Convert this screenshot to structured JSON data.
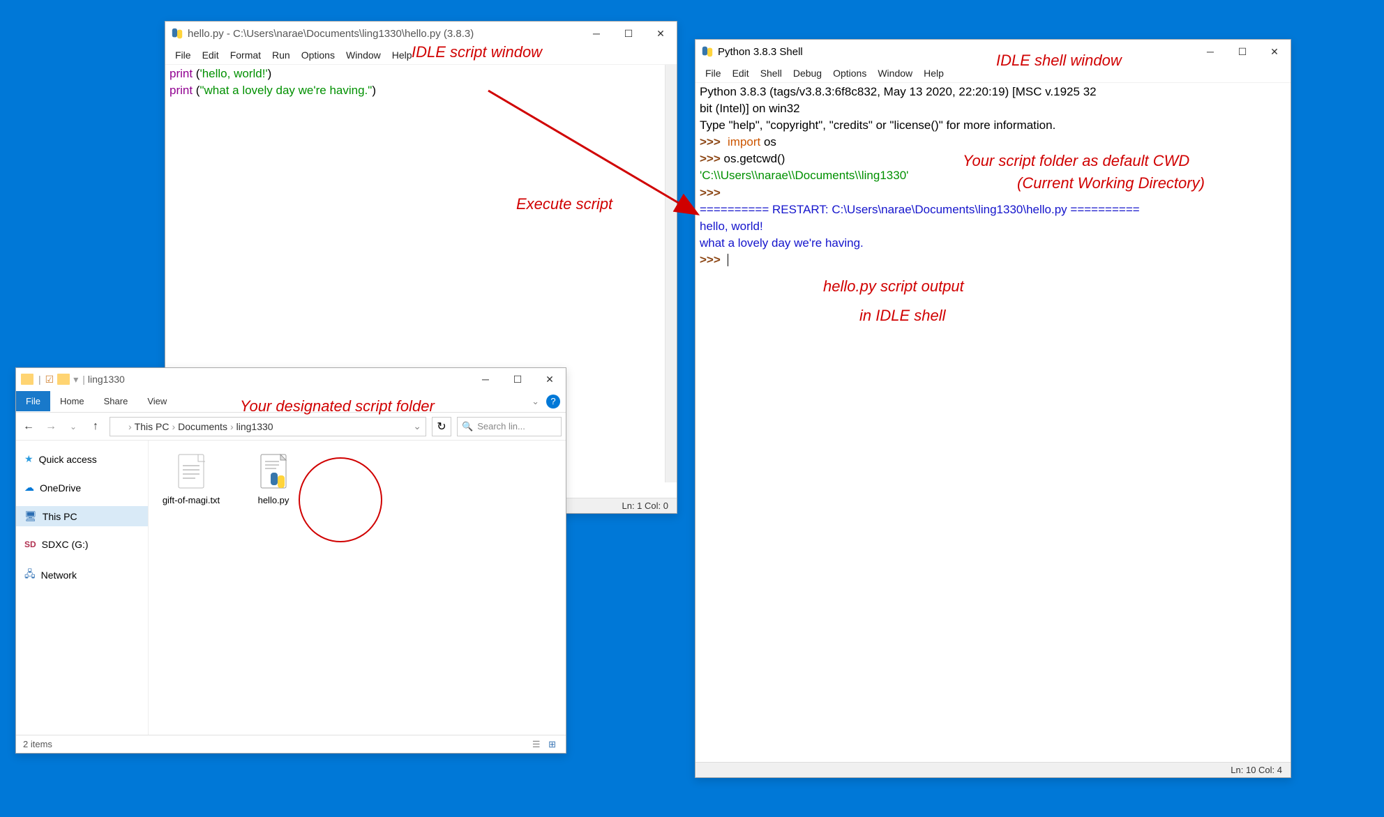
{
  "idle_script": {
    "title": "hello.py - C:\\Users\\narae\\Documents\\ling1330\\hello.py (3.8.3)",
    "menus": [
      "File",
      "Edit",
      "Format",
      "Run",
      "Options",
      "Window",
      "Help"
    ],
    "code": {
      "line1_fn": "print",
      "line1_rest": " (",
      "line1_str": "'hello, world!'",
      "line1_end": ")",
      "line2_fn": "print",
      "line2_rest": " (",
      "line2_str": "\"what a lovely day we're having.\"",
      "line2_end": ")"
    },
    "status": "Ln: 1  Col: 0"
  },
  "idle_shell": {
    "title": "Python 3.8.3 Shell",
    "menus": [
      "File",
      "Edit",
      "Shell",
      "Debug",
      "Options",
      "Window",
      "Help"
    ],
    "banner1": "Python 3.8.3 (tags/v3.8.3:6f8c832, May 13 2020, 22:20:19) [MSC v.1925 32",
    "banner2": "bit (Intel)] on win32",
    "banner3": "Type \"help\", \"copyright\", \"credits\" or \"license()\" for more information.",
    "prompt": ">>>",
    "import_kw": "import",
    "import_mod": " os",
    "getcwd": " os.getcwd()",
    "cwd_result": "'C:\\\\Users\\\\narae\\\\Documents\\\\ling1330'",
    "restart": "========== RESTART: C:\\Users\\narae\\Documents\\ling1330\\hello.py ==========",
    "out1": "hello, world!",
    "out2": "what a lovely day we're having.",
    "status": "Ln: 10  Col: 4"
  },
  "explorer": {
    "title_folder": "ling1330",
    "tabs": {
      "file": "File",
      "home": "Home",
      "share": "Share",
      "view": "View"
    },
    "breadcrumb": [
      "This PC",
      "Documents",
      "ling1330"
    ],
    "search_placeholder": "Search lin...",
    "sidebar": [
      {
        "label": "Quick access",
        "icon": "star-icon"
      },
      {
        "label": "OneDrive",
        "icon": "cloud-icon"
      },
      {
        "label": "This PC",
        "icon": "pc-icon"
      },
      {
        "label": "SDXC (G:)",
        "icon": "sd-icon"
      },
      {
        "label": "Network",
        "icon": "network-icon"
      }
    ],
    "files": [
      {
        "name": "gift-of-magi.txt",
        "icon": "txt-file-icon"
      },
      {
        "name": "hello.py",
        "icon": "python-file-icon"
      }
    ],
    "status": "2 items"
  },
  "annotations": {
    "script_window": "IDLE script window",
    "shell_window": "IDLE shell window",
    "execute": "Execute script",
    "cwd1": "Your script folder as default CWD",
    "cwd2": "(Current Working Directory)",
    "output1": "hello.py script output",
    "output2": "in IDLE shell",
    "folder": "Your designated script folder"
  }
}
